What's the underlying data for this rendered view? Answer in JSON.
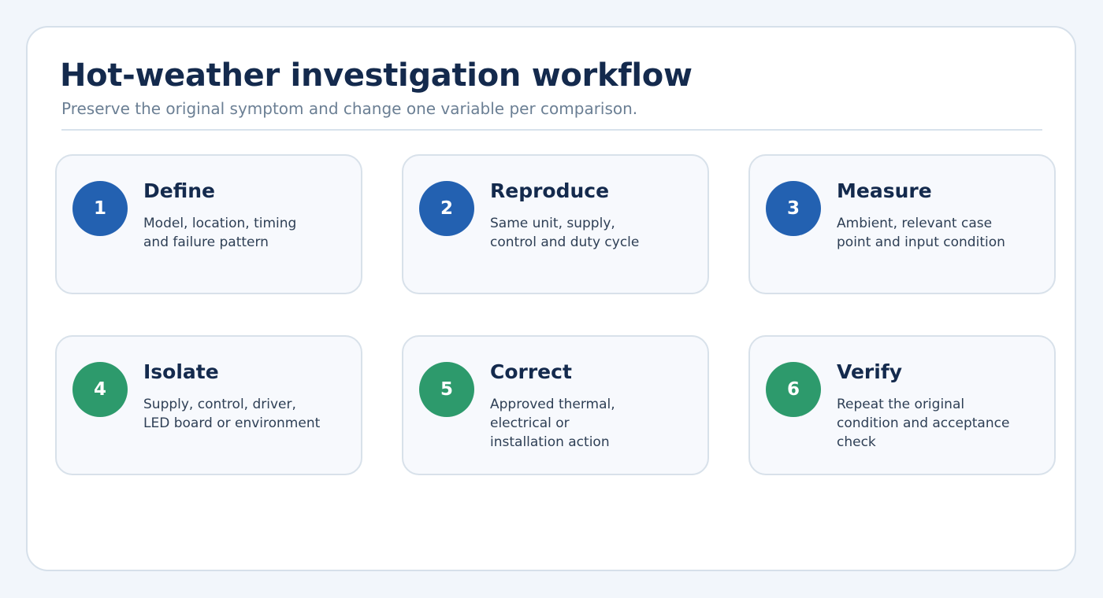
{
  "header": {
    "title": "Hot-weather investigation workflow",
    "subtitle": "Preserve the original symptom and change one variable per comparison."
  },
  "colors": {
    "blue_badge": "#2361b1",
    "green_badge": "#2d9a6c",
    "title_text": "#142a4d"
  },
  "steps": [
    {
      "number": "1",
      "title": "Define",
      "description": "Model, location, timing\nand failure pattern",
      "color": "blue"
    },
    {
      "number": "2",
      "title": "Reproduce",
      "description": "Same unit, supply,\ncontrol and duty cycle",
      "color": "blue"
    },
    {
      "number": "3",
      "title": "Measure",
      "description": "Ambient, relevant case\npoint and input condition",
      "color": "blue"
    },
    {
      "number": "4",
      "title": "Isolate",
      "description": "Supply, control, driver,\nLED board or environment",
      "color": "green"
    },
    {
      "number": "5",
      "title": "Correct",
      "description": "Approved thermal,\nelectrical or\ninstallation action",
      "color": "green"
    },
    {
      "number": "6",
      "title": "Verify",
      "description": "Repeat the original\ncondition and acceptance\ncheck",
      "color": "green"
    }
  ]
}
